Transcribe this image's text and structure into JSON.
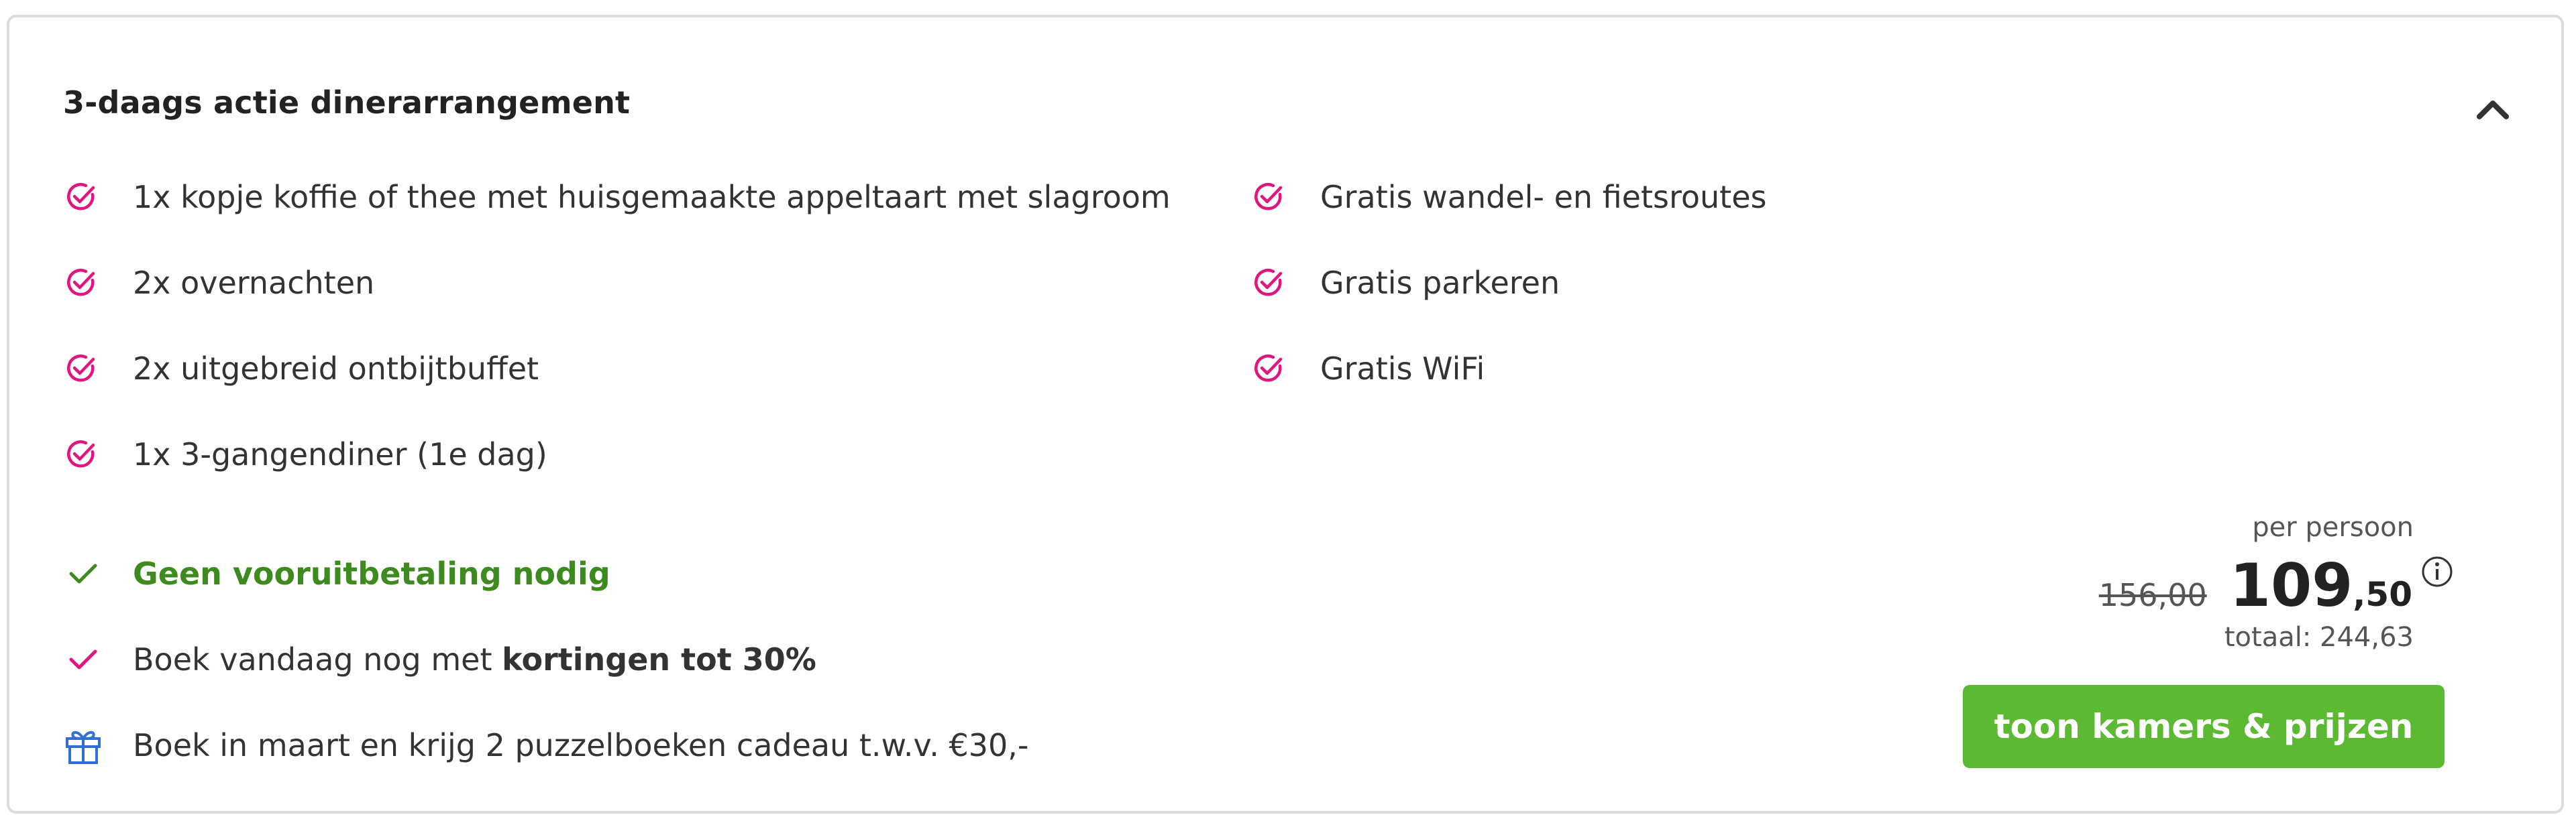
{
  "package": {
    "title": "3-daags actie dinerarrangement",
    "features_left": [
      {
        "label": "1x kopje koffie of thee met huisgemaakte appeltaart met slagroom",
        "icon": "check-circle-icon"
      },
      {
        "label": "2x overnachten",
        "icon": "check-circle-icon"
      },
      {
        "label": "2x uitgebreid ontbijtbuffet",
        "icon": "check-circle-icon"
      },
      {
        "label": "1x 3-gangendiner (1e dag)",
        "icon": "check-circle-icon"
      }
    ],
    "features_right": [
      {
        "label": "Gratis wandel- en fietsroutes",
        "icon": "check-circle-icon"
      },
      {
        "label": "Gratis parkeren",
        "icon": "check-circle-icon"
      },
      {
        "label": "Gratis WiFi",
        "icon": "check-circle-icon"
      }
    ],
    "perks": {
      "no_prepayment": "Geen vooruitbetaling nodig",
      "discount_prefix": "Boek vandaag nog met ",
      "discount_bold": "kortingen tot 30%",
      "gift": "Boek in maart en krijg 2 puzzelboeken cadeau t.w.v. €30,-"
    },
    "price": {
      "per_person_label": "per persoon",
      "old_price": "156,00",
      "new_price_int": "109",
      "new_price_dec": ",50",
      "total": "totaal: 244,63"
    },
    "cta_label": "toon kamers & prijzen"
  },
  "colors": {
    "accent_pink": "#e0157e",
    "green_text": "#3d8b1e",
    "cta_green": "#5cb932",
    "gift_blue": "#2f6fd6"
  }
}
